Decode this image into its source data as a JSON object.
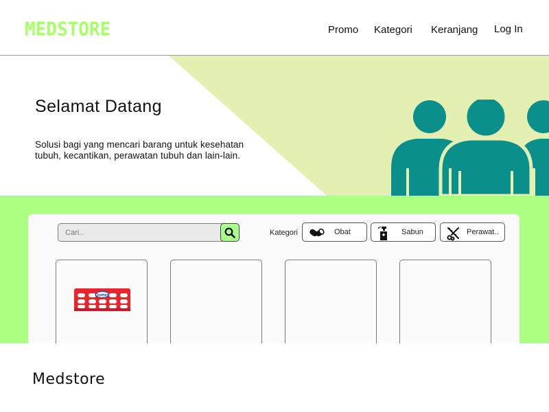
{
  "header": {
    "logo": "MEDSTORE",
    "nav": {
      "promo": "Promo",
      "kategori": "Kategori",
      "keranjang": "Keranjang",
      "login": "Log In"
    }
  },
  "hero": {
    "title": "Selamat Datang",
    "description": "Solusi bagi yang mencari barang untuk kesehatan tubuh, kecantikan, perawatan tubuh dan lain-lain.",
    "icon": "people-group-icon"
  },
  "search": {
    "placeholder": "Cari..",
    "button_icon": "search-icon"
  },
  "categories": {
    "label": "Kategori",
    "items": [
      {
        "label": "Obat",
        "icon": "pill-icon"
      },
      {
        "label": "Sabun",
        "icon": "soap-bottle-icon"
      },
      {
        "label": "Perawat..",
        "icon": "scissors-comb-icon"
      }
    ]
  },
  "products": [
    {
      "image": "pill-blister-pack",
      "image_label": "Dumex"
    },
    {
      "image": ""
    },
    {
      "image": ""
    },
    {
      "image": ""
    }
  ],
  "footer": {
    "brand": "Medstore"
  },
  "colors": {
    "brand_green": "#a8ff6a",
    "section_green": "#acff80",
    "hero_accent": "#e4efb2",
    "people_teal": "#0b8f8a",
    "blister_red": "#e8252a"
  }
}
